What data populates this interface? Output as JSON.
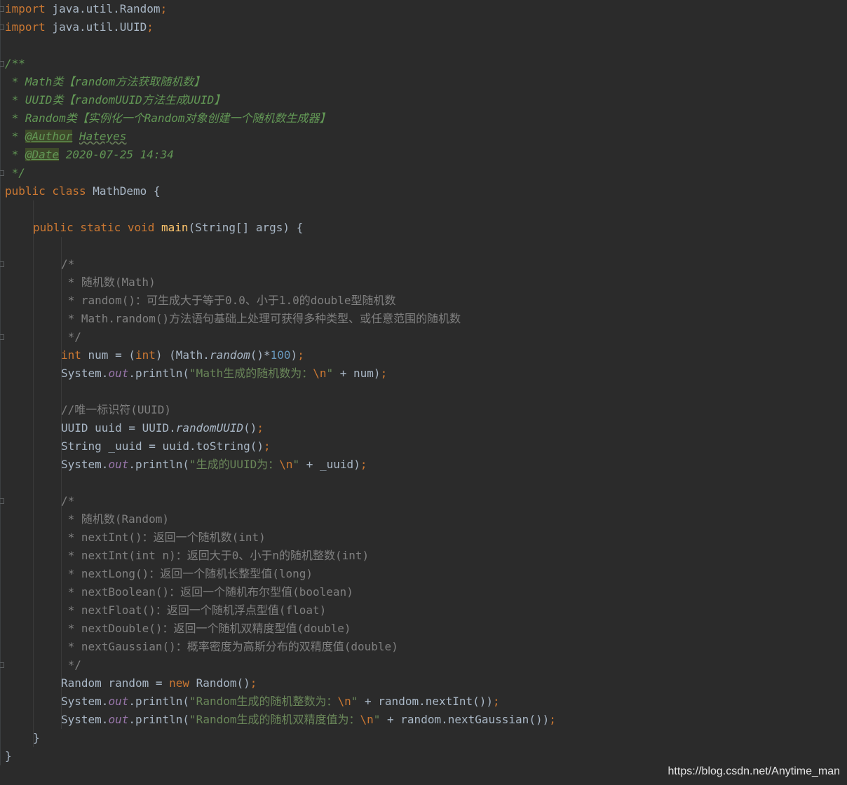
{
  "editor": {
    "language": "java",
    "theme": "darcula",
    "lines": {
      "l1_kw": "import",
      "l1_rest": " java.util.Random",
      "l2_kw": "import",
      "l2_rest": " java.util.UUID",
      "semicolon": ";",
      "doc_open": "/**",
      "doc1": " * Math类【random方法获取随机数】",
      "doc2": " * UUID类【randomUUID方法生成UUID】",
      "doc3": " * Random类【实例化一个Random对象创建一个随机数生成器】",
      "doc_star": " * ",
      "author_tag": "@Author",
      "author_value": "Hateyes",
      "date_tag": "@Date",
      "date_value": " 2020-07-25 14:34",
      "doc_close": " */",
      "class_kw": "public class",
      "class_name": " MathDemo {",
      "main_mods": "public static void",
      "main_name": "main",
      "main_params": "(String[] args) {",
      "c1_open": "/*",
      "c1_l1": " * 随机数(Math)",
      "c1_l2": " * random()：可生成大于等于0.0、小于1.0的double型随机数",
      "c1_l3": " * Math.random()方法语句基础上处理可获得多种类型、或任意范围的随机数",
      "c_close": " */",
      "int_kw": "int",
      "num_mid": " num = (",
      "num_cast": "int",
      "num_rest": ") (Math.",
      "random_fn": "random",
      "num_mul": "()*",
      "num_val": "100",
      "close_paren": ")",
      "sys": "System.",
      "out": "out",
      "println": ".println(",
      "s_math": "\"Math生成的随机数为：",
      "esc_n": "\\n",
      "quote": "\"",
      "plus_num": " + num)",
      "uuid_cmt": "//唯一标识符(UUID)",
      "uuid_decl": "UUID uuid = UUID.",
      "uuid_fn": "randomUUID",
      "parens": "()",
      "str_decl": "String _uuid = uuid.toString()",
      "s_uuid": "\"生成的UUID为：",
      "plus_uuid": " + _uuid)",
      "c2_l1": " * 随机数(Random)",
      "c2_l2": " * nextInt()：返回一个随机数(int)",
      "c2_l3": " * nextInt(int n)：返回大于0、小于n的随机整数(int)",
      "c2_l4": " * nextLong()：返回一个随机长整型值(long)",
      "c2_l5": " * nextBoolean()：返回一个随机布尔型值(boolean)",
      "c2_l6": " * nextFloat()：返回一个随机浮点型值(float)",
      "c2_l7": " * nextDouble()：返回一个随机双精度型值(double)",
      "c2_l8": " * nextGaussian()：概率密度为高斯分布的双精度值(double)",
      "rand_decl": "Random random = ",
      "new_kw": "new",
      "rand_ctor": " Random()",
      "s_rand_int": "\"Random生成的随机整数为：",
      "plus_next_int": " + random.nextInt())",
      "s_rand_dbl": "\"Random生成的随机双精度值为：",
      "plus_next_gauss": " + random.nextGaussian())",
      "brace_close": "}"
    }
  },
  "watermark": "https://blog.csdn.net/Anytime_man"
}
